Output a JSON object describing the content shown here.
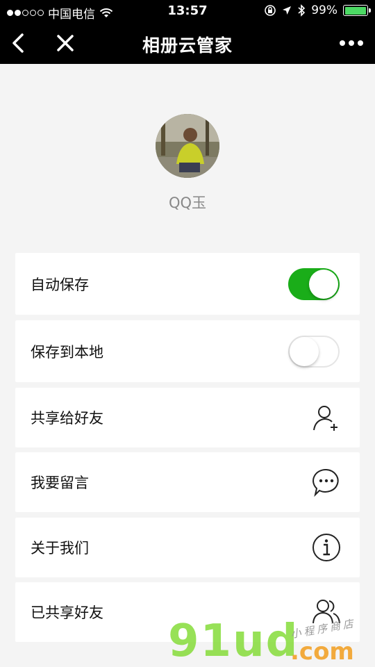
{
  "status_bar": {
    "carrier": "中国电信",
    "time": "13:57",
    "battery_percent": "99%",
    "battery_level": 0.99,
    "signal_dots_filled": 2,
    "signal_dots_total": 5
  },
  "nav": {
    "title": "相册云管家",
    "back_icon": "chevron-left-icon",
    "close_icon": "close-icon",
    "more_icon": "more-icon"
  },
  "profile": {
    "username": "QQ玉"
  },
  "menu": [
    {
      "label": "自动保存",
      "control": "toggle",
      "on": true
    },
    {
      "label": "保存到本地",
      "control": "toggle",
      "on": false
    },
    {
      "label": "共享给好友",
      "control": "icon",
      "icon": "add-user-icon"
    },
    {
      "label": "我要留言",
      "control": "icon",
      "icon": "message-icon"
    },
    {
      "label": "关于我们",
      "control": "icon",
      "icon": "info-icon"
    },
    {
      "label": "已共享好友",
      "control": "icon",
      "icon": "users-icon"
    }
  ],
  "watermark": {
    "brand": "91ud",
    "domain": ".com",
    "subtitle": "小程序商店"
  },
  "colors": {
    "toggle_on": "#1aad19",
    "bar": "#000000",
    "background": "#f4f4f4"
  }
}
